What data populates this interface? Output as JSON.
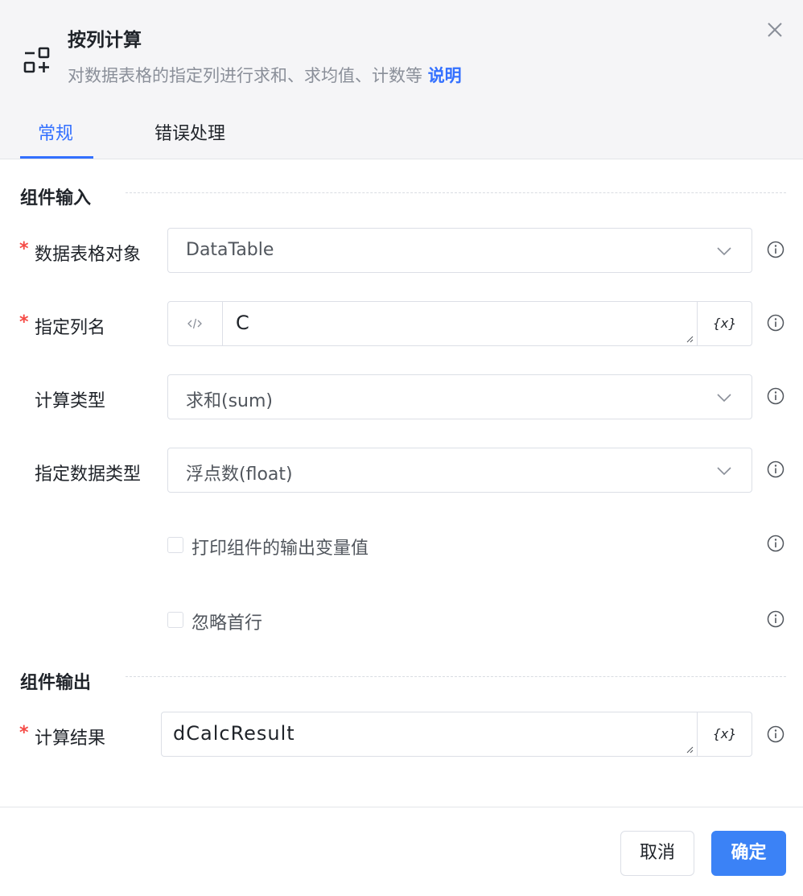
{
  "header": {
    "title": "按列计算",
    "subtitle": "对数据表格的指定列进行求和、求均值、计数等",
    "help_link": "说明"
  },
  "tabs": [
    {
      "label": "常规",
      "active": true
    },
    {
      "label": "错误处理",
      "active": false
    }
  ],
  "input_section": {
    "title": "组件输入",
    "fields": {
      "datatable": {
        "label": "数据表格对象",
        "required_mark": "*",
        "value": "DataTable"
      },
      "column": {
        "label": "指定列名",
        "required_mark": "*",
        "value": "C",
        "var_button": "{x}"
      },
      "calc_type": {
        "label": "计算类型",
        "value": "求和(sum)"
      },
      "data_type": {
        "label": "指定数据类型",
        "value": "浮点数(float)"
      }
    },
    "checkboxes": {
      "print_output": {
        "label": "打印组件的输出变量值",
        "checked": false
      },
      "skip_header": {
        "label": "忽略首行",
        "checked": false
      }
    }
  },
  "output_section": {
    "title": "组件输出",
    "result": {
      "label": "计算结果",
      "required_mark": "*",
      "value": "dCalcResult",
      "var_button": "{x}"
    }
  },
  "footer": {
    "cancel_label": "取消",
    "ok_label": "确定"
  },
  "colors": {
    "accent": "#3370ff",
    "primary_button": "#3b82f6",
    "required": "#f54a45"
  },
  "icons": [
    "component-icon",
    "close-icon",
    "chevron-down-icon",
    "code-icon",
    "info-icon",
    "resize-grip-icon"
  ]
}
